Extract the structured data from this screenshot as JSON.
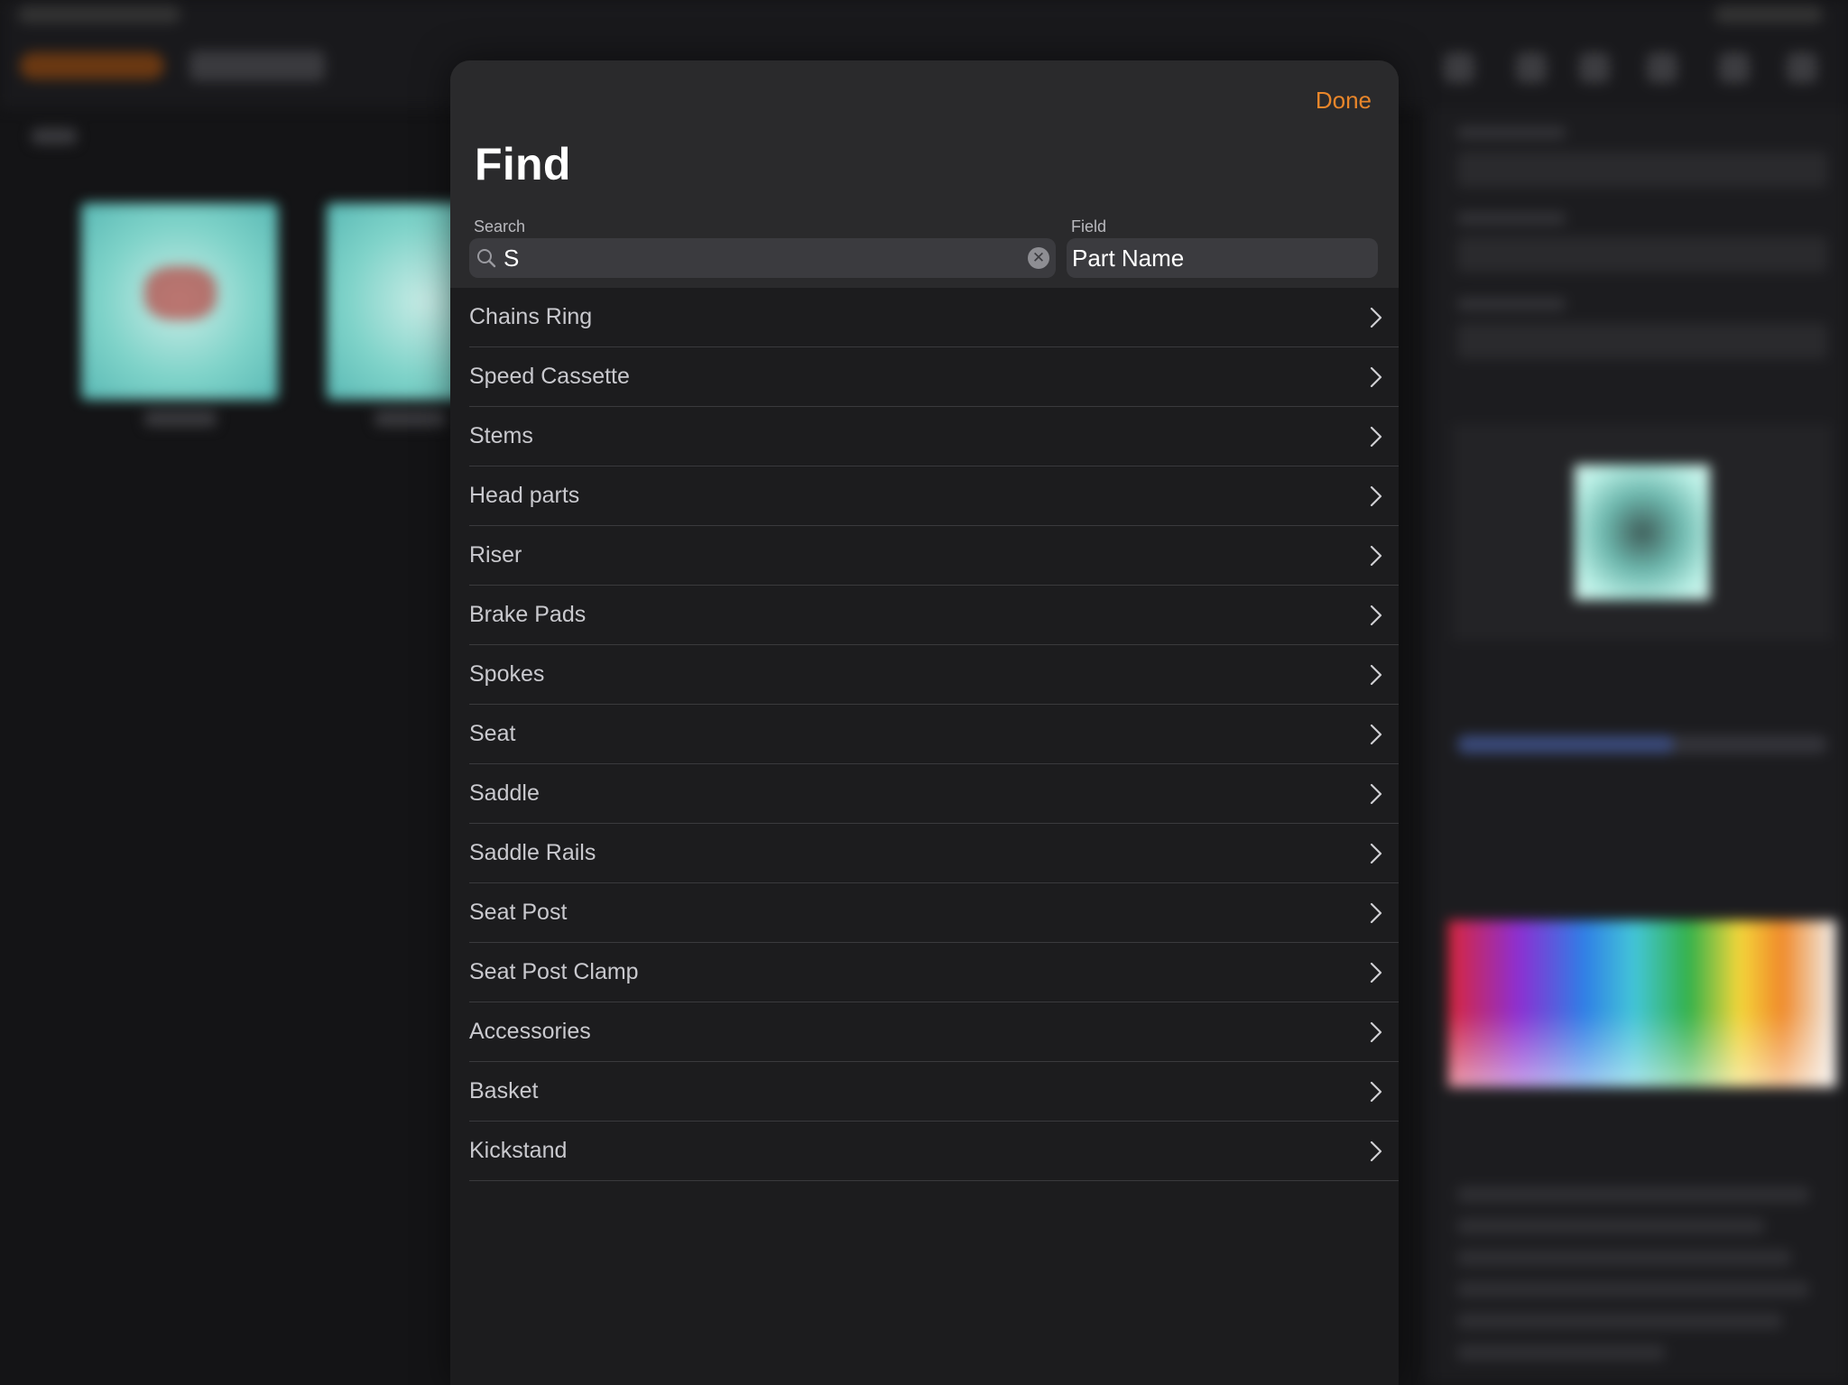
{
  "find_sheet": {
    "done_label": "Done",
    "title": "Find",
    "search": {
      "caption": "Search",
      "value": "S",
      "icon": "magnifying-glass-icon",
      "clear_icon": "clear-circle-icon"
    },
    "field": {
      "caption": "Field",
      "value": "Part Name"
    },
    "results": [
      {
        "label": "Chains Ring"
      },
      {
        "label": "Speed Cassette"
      },
      {
        "label": "Stems"
      },
      {
        "label": "Head parts"
      },
      {
        "label": "Riser"
      },
      {
        "label": "Brake Pads"
      },
      {
        "label": "Spokes"
      },
      {
        "label": "Seat"
      },
      {
        "label": "Saddle"
      },
      {
        "label": "Saddle Rails"
      },
      {
        "label": "Seat Post"
      },
      {
        "label": "Seat Post Clamp"
      },
      {
        "label": "Accessories"
      },
      {
        "label": "Basket"
      },
      {
        "label": "Kickstand"
      }
    ]
  },
  "colors": {
    "accent": "#e9862a",
    "sheet_background": "#1c1c1e",
    "header_background": "#2a2a2c",
    "input_background": "#3b3b3f"
  }
}
